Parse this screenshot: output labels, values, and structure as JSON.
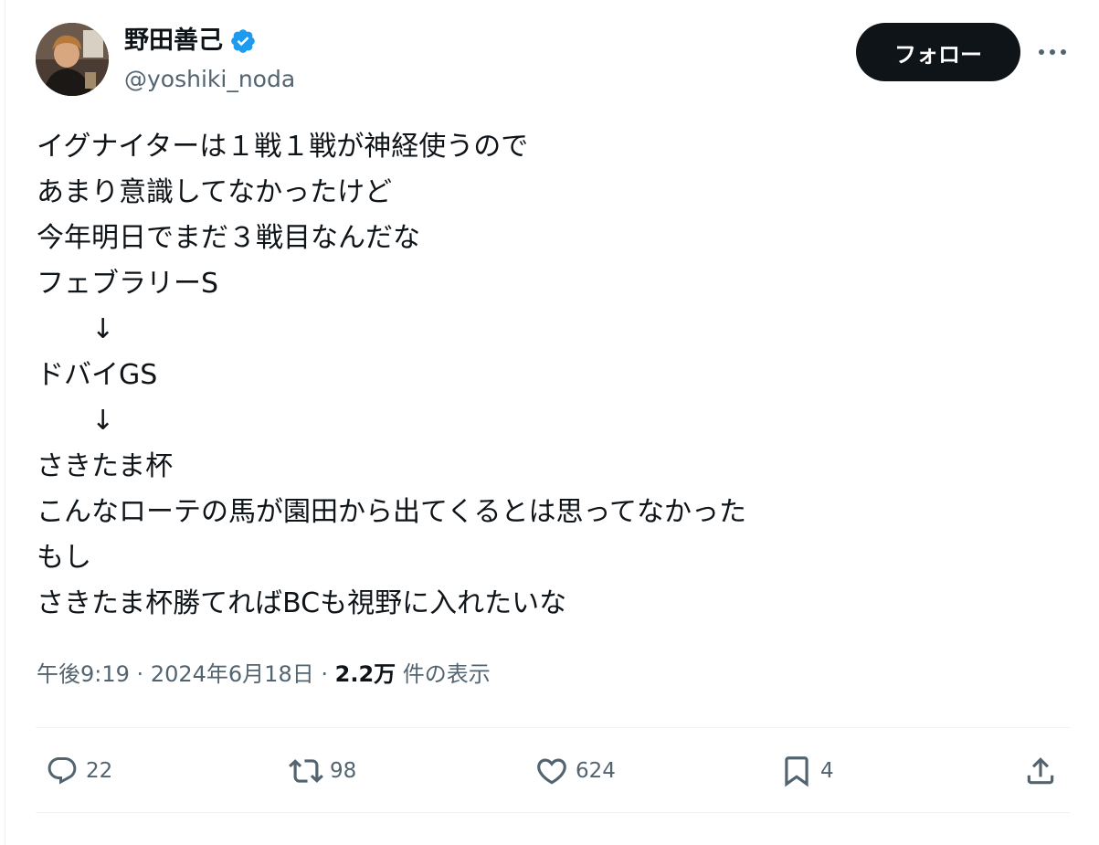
{
  "author": {
    "display_name": "野田善己",
    "handle": "@yoshiki_noda",
    "verified": true,
    "verified_color": "#1d9bf0"
  },
  "header": {
    "follow_label": "フォロー",
    "more_icon": "more-horizontal-icon"
  },
  "tweet": {
    "lines": [
      "イグナイターは１戦１戦が神経使うので",
      "あまり意識してなかったけど",
      "今年明日でまだ３戦目なんだな",
      "フェブラリーS",
      "　　↓",
      "ドバイGS",
      "　　↓",
      "さきたま杯",
      "こんなローテの馬が園田から出てくるとは思ってなかった",
      "もし",
      "さきたま杯勝てればBCも視野に入れたいな"
    ]
  },
  "meta": {
    "time": "午後9:19",
    "separator": "·",
    "date": "2024年6月18日",
    "views_count": "2.2万",
    "views_label": "件の表示"
  },
  "actions": {
    "reply": {
      "icon": "reply-icon",
      "count": "22"
    },
    "retweet": {
      "icon": "retweet-icon",
      "count": "98"
    },
    "like": {
      "icon": "heart-icon",
      "count": "624"
    },
    "bookmark": {
      "icon": "bookmark-icon",
      "count": "4"
    },
    "share": {
      "icon": "share-icon"
    }
  },
  "colors": {
    "text_primary": "#0f1419",
    "text_secondary": "#536471",
    "divider": "#eff3f4",
    "button_bg": "#0f1419"
  }
}
